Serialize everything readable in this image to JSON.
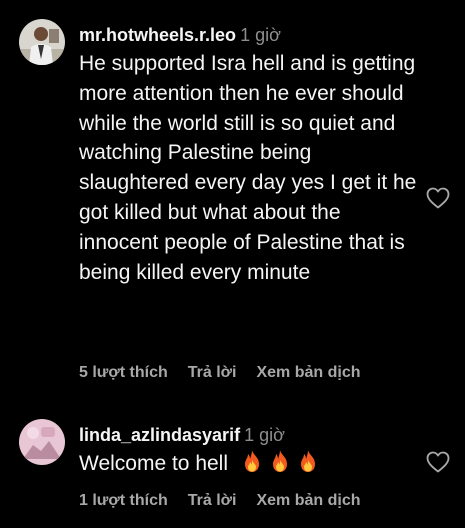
{
  "comments": [
    {
      "username": "mr.hotwheels.r.leo",
      "time": "1 giờ",
      "text": "He supported Isra hell and is getting more attention then he ever should while the world still is so quiet and watching Palestine being slaughtered every day yes I get it he got killed but what about the innocent people of Palestine that is being killed every minute",
      "likes": "5 lượt thích",
      "reply": "Trả lời",
      "translate": "Xem bản dịch",
      "avatar_icon": "man-portrait-avatar"
    },
    {
      "username": "linda_azlindasyarif",
      "time": "1 giờ",
      "text": "Welcome to hell",
      "emoji": [
        "🔥",
        "🔥",
        "🔥"
      ],
      "likes": "1 lượt thích",
      "reply": "Trả lời",
      "translate": "Xem bản dịch",
      "avatar_icon": "pink-portrait-avatar"
    }
  ],
  "colors": {
    "background": "#000000",
    "text": "#f5f5f5",
    "muted": "#8e8e8e",
    "actions": "#a8a8a8"
  }
}
